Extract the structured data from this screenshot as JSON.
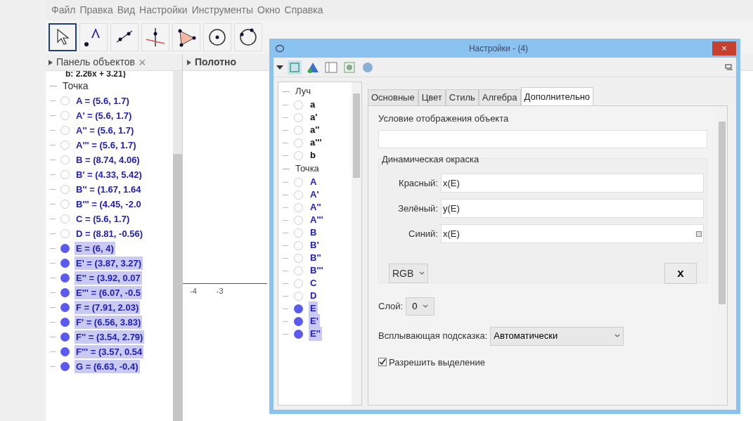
{
  "menu": [
    "Файл",
    "Правка",
    "Вид",
    "Настройки",
    "Инструменты",
    "Окно",
    "Справка"
  ],
  "algebra_panel": {
    "title": "Панель объектов",
    "close": "×",
    "group": "Точка",
    "top_item": "b: 2.26x + 3.21)",
    "items": [
      {
        "label": "A = (5.6, 1.7)",
        "selected": false
      },
      {
        "label": "A' = (5.6, 1.7)",
        "selected": false
      },
      {
        "label": "A'' = (5.6, 1.7)",
        "selected": false
      },
      {
        "label": "A''' = (5.6, 1.7)",
        "selected": false
      },
      {
        "label": "B = (8.74, 4.06)",
        "selected": false
      },
      {
        "label": "B' = (4.33, 5.42)",
        "selected": false
      },
      {
        "label": "B'' = (1.67, 1.64",
        "selected": false
      },
      {
        "label": "B''' = (4.45, -2.0",
        "selected": false
      },
      {
        "label": "C = (5.6, 1.7)",
        "selected": false
      },
      {
        "label": "D = (8.81, -0.56)",
        "selected": false
      },
      {
        "label": "E = (6, 4)",
        "selected": true
      },
      {
        "label": "E' = (3.87, 3.27)",
        "selected": true
      },
      {
        "label": "E'' = (3.92, 0.07",
        "selected": true
      },
      {
        "label": "E''' = (6.07, -0.5",
        "selected": true
      },
      {
        "label": "F = (7.91, 2.03)",
        "selected": true
      },
      {
        "label": "F' = (6.56, 3.83)",
        "selected": true
      },
      {
        "label": "F'' = (3.54, 2.79)",
        "selected": true
      },
      {
        "label": "F''' = (3.57, 0.54",
        "selected": true
      },
      {
        "label": "G = (6.63, -0.4)",
        "selected": true
      }
    ]
  },
  "graphics_panel": {
    "title": "Полотно",
    "x_ticks": [
      "-4",
      "-3"
    ]
  },
  "dialog": {
    "title": "Настройки - (4)",
    "close": "×",
    "tree": [
      {
        "label": "Луч",
        "children": [
          {
            "label": "a",
            "selected": false
          },
          {
            "label": "a'",
            "selected": false
          },
          {
            "label": "a''",
            "selected": false
          },
          {
            "label": "a'''",
            "selected": false
          },
          {
            "label": "b",
            "selected": false
          }
        ]
      },
      {
        "label": "Точка",
        "children": [
          {
            "label": "A",
            "selected": false
          },
          {
            "label": "A'",
            "selected": false
          },
          {
            "label": "A''",
            "selected": false
          },
          {
            "label": "A'''",
            "selected": false
          },
          {
            "label": "B",
            "selected": false
          },
          {
            "label": "B'",
            "selected": false
          },
          {
            "label": "B''",
            "selected": false
          },
          {
            "label": "B'''",
            "selected": false
          },
          {
            "label": "C",
            "selected": false
          },
          {
            "label": "D",
            "selected": false
          },
          {
            "label": "E",
            "selected": true
          },
          {
            "label": "E'",
            "selected": true
          },
          {
            "label": "E''",
            "selected": true
          }
        ]
      }
    ],
    "tabs": [
      {
        "label": "Основные",
        "selected": false
      },
      {
        "label": "Цвет",
        "selected": false
      },
      {
        "label": "Стиль",
        "selected": false
      },
      {
        "label": "Алгебра",
        "selected": false
      },
      {
        "label": "Дополнительно",
        "selected": true
      }
    ],
    "condition": {
      "label": "Условие отображения объекта"
    },
    "dynamic_color": {
      "title": "Динамическая окраска",
      "fields": [
        {
          "label": "Красный:",
          "value": "x(E)"
        },
        {
          "label": "Зелёный:",
          "value": "y(E)"
        },
        {
          "label": "Синий:",
          "value": "x(E)"
        }
      ],
      "mode": "RGB",
      "clear": "x"
    },
    "layer": {
      "label": "Слой:",
      "value": "0"
    },
    "tooltip": {
      "label": "Всплывающая подсказка:",
      "value": "Автоматически"
    },
    "selection": {
      "label": "Разрешить выделение",
      "checked": true
    }
  }
}
